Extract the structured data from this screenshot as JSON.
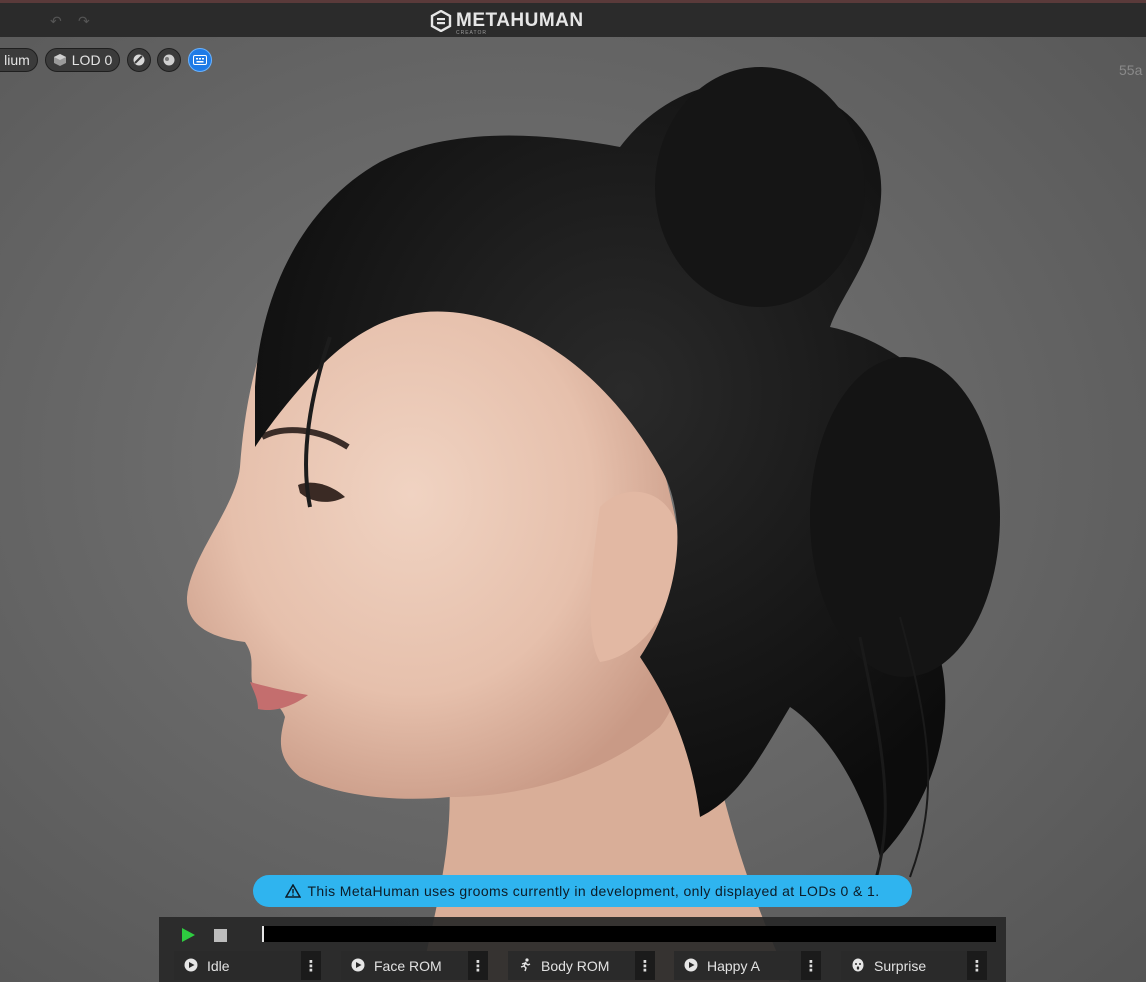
{
  "app": {
    "brand": "METAHUMAN",
    "brand_sub": "CREATOR",
    "undo_icon": "undo-icon",
    "redo_icon": "redo-icon"
  },
  "viewport": {
    "quality_label": "lium",
    "lod_label": "LOD 0",
    "watermark": "55a",
    "toggles": [
      "grooms-icon",
      "lighting-icon",
      "keyboard-icon"
    ],
    "active_toggle_color": "#1f7be6"
  },
  "warning": {
    "text": "This MetaHuman uses grooms currently in development, only displayed at LODs 0 & 1.",
    "color": "#2fb4ef"
  },
  "playback": {
    "play_color": "#2ecc40",
    "animations": [
      {
        "label": "Idle",
        "icon": "play-circle-icon"
      },
      {
        "label": "Face ROM",
        "icon": "play-circle-icon"
      },
      {
        "label": "Body ROM",
        "icon": "running-figure-icon"
      },
      {
        "label": "Happy A",
        "icon": "face-icon"
      },
      {
        "label": "Surprise",
        "icon": "face-icon"
      }
    ]
  }
}
